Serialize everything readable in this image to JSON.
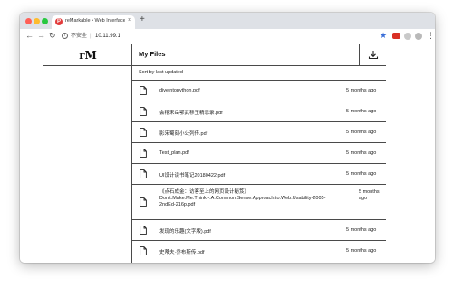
{
  "browser": {
    "tab_title": "reMarkable • Web Interface",
    "tab_favicon": "P",
    "tab_close": "×",
    "new_tab": "+",
    "security_label": "不安全",
    "url_separator": "|",
    "url": "10.11.99.1",
    "icons": [
      "back-arrow-icon",
      "forward-arrow-icon",
      "reload-icon",
      "info-icon",
      "bookmark-star-icon",
      "extension-icon",
      "profile-icon",
      "menu-dots-icon"
    ]
  },
  "app": {
    "logo": "rM",
    "page_title": "My Files",
    "sort_label": "Sort by last updated"
  },
  "files": [
    {
      "name": "diveintopython.pdf",
      "updated": "5 months ago"
    },
    {
      "name": "会稽宋岳鄂武穆王精忠录.pdf",
      "updated": "5 months ago"
    },
    {
      "name": "影宋蜀刻小公列传.pdf",
      "updated": "5 months ago"
    },
    {
      "name": "Test_plan.pdf",
      "updated": "5 months ago"
    },
    {
      "name": "UI设计读书笔记20180422.pdf",
      "updated": "5 months ago"
    },
    {
      "name": "《点石成金：访客至上的网页设计秘笈》Don't.Make.Me.Think.-.A.Common.Sense.Approach.to.Web.Usability-2005-2ndEd-216p.pdf",
      "updated": "5 months ago"
    },
    {
      "name": "发现的乐趣(文字版).pdf",
      "updated": "5 months ago"
    },
    {
      "name": "史蒂夫·乔布斯传.pdf",
      "updated": "5 months ago"
    }
  ]
}
